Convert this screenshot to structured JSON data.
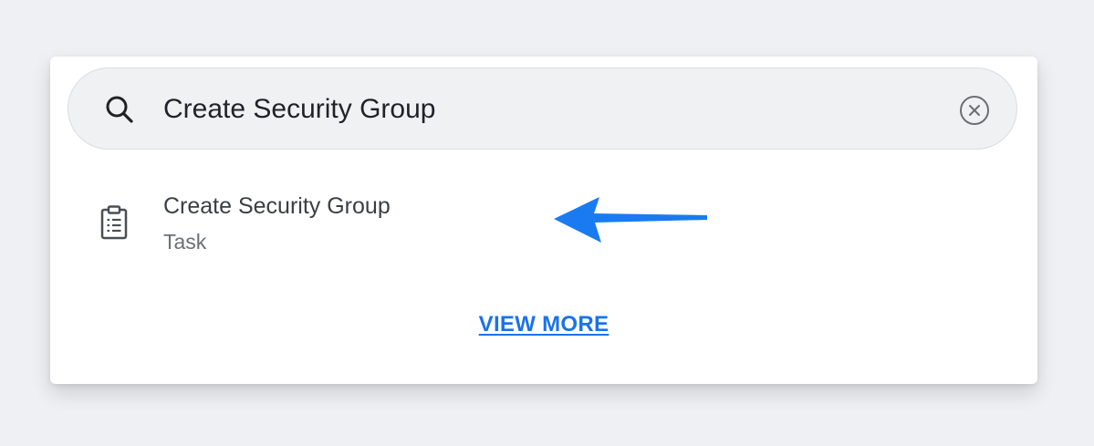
{
  "search": {
    "value": "Create Security Group",
    "search_icon": "search-icon",
    "clear_icon": "clear-circle-x-icon"
  },
  "results": [
    {
      "title": "Create Security Group",
      "subtitle": "Task",
      "icon": "clipboard-task-icon"
    }
  ],
  "annotation": {
    "type": "arrow-left",
    "color": "#1a7bf0"
  },
  "footer": {
    "view_more_label": "VIEW MORE"
  },
  "colors": {
    "page_background": "#eef0f3",
    "search_background": "#f0f1f3",
    "link": "#1a73e8"
  }
}
